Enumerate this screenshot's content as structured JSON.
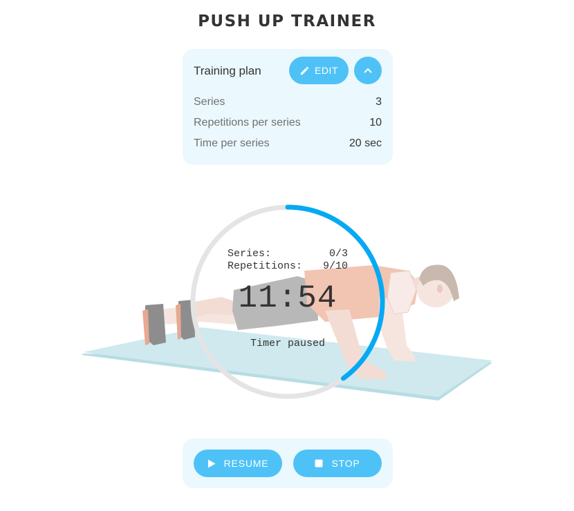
{
  "app": {
    "title": "PUSH UP TRAINER"
  },
  "plan": {
    "title": "Training plan",
    "edit_label": "EDIT",
    "collapse_icon": "chevron-up-icon",
    "rows": [
      {
        "label": "Series",
        "value": "3"
      },
      {
        "label": "Repetitions per series",
        "value": "10"
      },
      {
        "label": "Time per series",
        "value": "20 sec"
      }
    ]
  },
  "timer": {
    "series_label": "Series:",
    "series_value": "0/3",
    "reps_label": "Repetitions:",
    "reps_value": "9/10",
    "clock": "11:54",
    "status": "Timer paused",
    "progress": 0.4
  },
  "controls": {
    "resume_label": "RESUME",
    "resume_icon": "play-icon",
    "stop_label": "STOP",
    "stop_icon": "stop-icon"
  },
  "colors": {
    "accent": "#4ec2f7",
    "ring_active": "#05a9f4",
    "ring_track": "#e4e4e4",
    "card_bg": "#ebf8fd",
    "mat": "#cfe9ee"
  }
}
